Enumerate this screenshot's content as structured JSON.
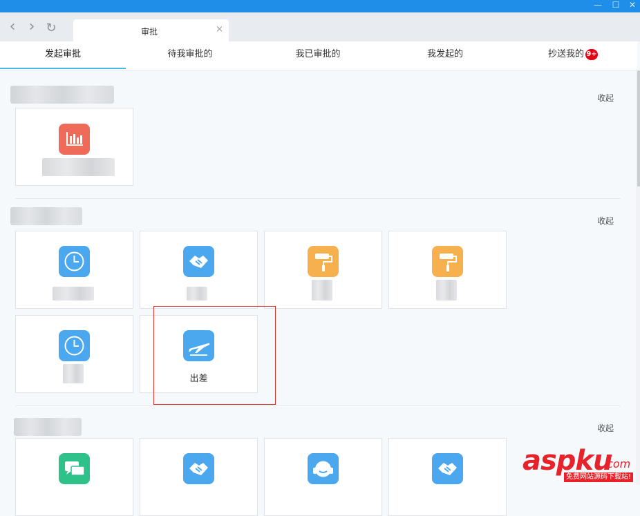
{
  "window": {
    "minimize_icon": "—",
    "maximize_icon": "☐",
    "close_icon": "✕"
  },
  "toolbar": {
    "back_icon": "‹",
    "forward_icon": "›",
    "reload_icon": "↻"
  },
  "tab": {
    "title": "审批",
    "close_icon": "×"
  },
  "subnav": {
    "tabs": [
      {
        "label": "发起审批",
        "active": true
      },
      {
        "label": "待我审批的"
      },
      {
        "label": "我已审批的"
      },
      {
        "label": "我发起的"
      },
      {
        "label": "抄送我的",
        "badge": "9+"
      }
    ]
  },
  "sections": [
    {
      "collapse_label": "收起",
      "cards": [
        {
          "icon": "bar-chart-icon",
          "color": "#f06a5a",
          "label": ""
        }
      ]
    },
    {
      "collapse_label": "收起",
      "cards": [
        {
          "icon": "clock-icon",
          "color": "#4ba7ee",
          "label": ""
        },
        {
          "icon": "handshake-icon",
          "color": "#4ba7ee",
          "label": ""
        },
        {
          "icon": "paint-roller-icon",
          "color": "#f7b04e",
          "label": ""
        },
        {
          "icon": "paint-roller-icon",
          "color": "#f7b04e",
          "label": ""
        },
        {
          "icon": "clock-icon",
          "color": "#4ba7ee",
          "label": ""
        },
        {
          "icon": "airplane-icon",
          "color": "#4ba7ee",
          "label": "出差"
        }
      ]
    },
    {
      "collapse_label": "收起",
      "cards": [
        {
          "icon": "chat-icon",
          "color": "#2ec18a"
        },
        {
          "icon": "handshake-icon",
          "color": "#4ba7ee"
        },
        {
          "icon": "headset-icon",
          "color": "#4ba7ee"
        },
        {
          "icon": "handshake-icon",
          "color": "#4ba7ee"
        }
      ]
    }
  ],
  "watermark": {
    "main": "aspku",
    "suffix": ".com",
    "subtitle": "免费网站源码下载站!"
  }
}
